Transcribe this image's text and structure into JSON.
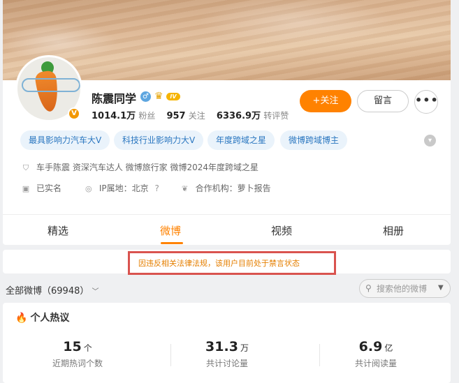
{
  "profile": {
    "name": "陈震同学",
    "level_badge": "IV",
    "verified_badge": "V",
    "followers_value": "1014.1万",
    "followers_label": "粉丝",
    "following_value": "957",
    "following_label": "关注",
    "reposts_value": "6336.9万",
    "reposts_label": "转评赞"
  },
  "actions": {
    "follow_label": "+关注",
    "message_label": "留言",
    "more_label": "•••"
  },
  "tags": [
    "最具影响力汽车大V",
    "科技行业影响力大V",
    "年度跨域之星",
    "微博跨域博主"
  ],
  "info": {
    "description": "车手陈震 资深汽车达人 微博旅行家 微博2024年度跨域之星",
    "real_name": "已实名",
    "ip_location": "IP属地：北京",
    "ip_help": "?",
    "cooperation": "合作机构：",
    "cooperation_org": "萝卜报告"
  },
  "tabs": [
    "精选",
    "微博",
    "视频",
    "相册"
  ],
  "active_tab": 1,
  "notice": "因违反相关法律法规，该用户目前处于禁言状态",
  "feed": {
    "filter_label": "全部微博（69948）",
    "search_placeholder": "搜索他的微博"
  },
  "heat": {
    "title": "个人热议",
    "stats": [
      {
        "value": "15",
        "unit": "个",
        "label": "近期热词个数"
      },
      {
        "value": "31.3",
        "unit": "万",
        "label": "共计讨论量"
      },
      {
        "value": "6.9",
        "unit": "亿",
        "label": "共计阅读量"
      }
    ]
  },
  "colors": {
    "accent": "#ff8200",
    "tag_bg": "#eaf3fb",
    "tag_text": "#2b77c0",
    "notice_border": "#d9534f",
    "notice_text": "#e57f00"
  }
}
